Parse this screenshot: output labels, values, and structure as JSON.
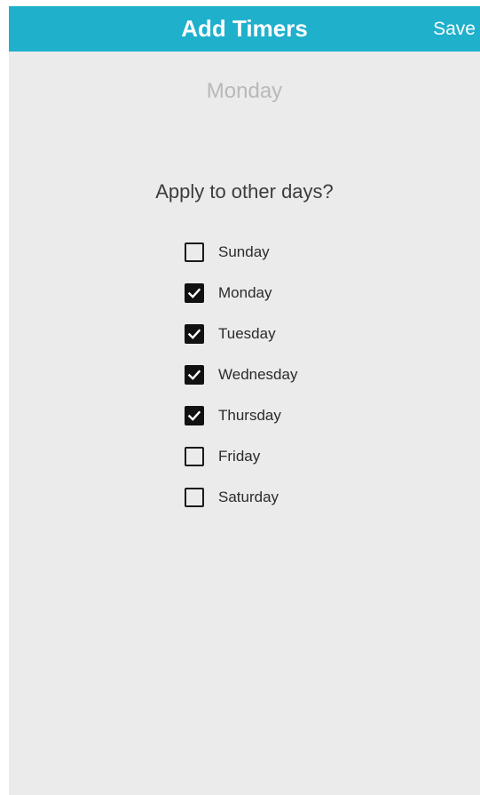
{
  "header": {
    "title": "Add Timers",
    "save_label": "Save"
  },
  "selected_day": "Monday",
  "apply_prompt": "Apply to other days?",
  "days": [
    {
      "label": "Sunday",
      "checked": false
    },
    {
      "label": "Monday",
      "checked": true
    },
    {
      "label": "Tuesday",
      "checked": true
    },
    {
      "label": "Wednesday",
      "checked": true
    },
    {
      "label": "Thursday",
      "checked": true
    },
    {
      "label": "Friday",
      "checked": false
    },
    {
      "label": "Saturday",
      "checked": false
    }
  ],
  "colors": {
    "app_bar": "#1fb0cc",
    "background": "#ebebeb",
    "checkbox_checked": "#111111"
  },
  "icons": {
    "checked": "checkmark-icon"
  }
}
